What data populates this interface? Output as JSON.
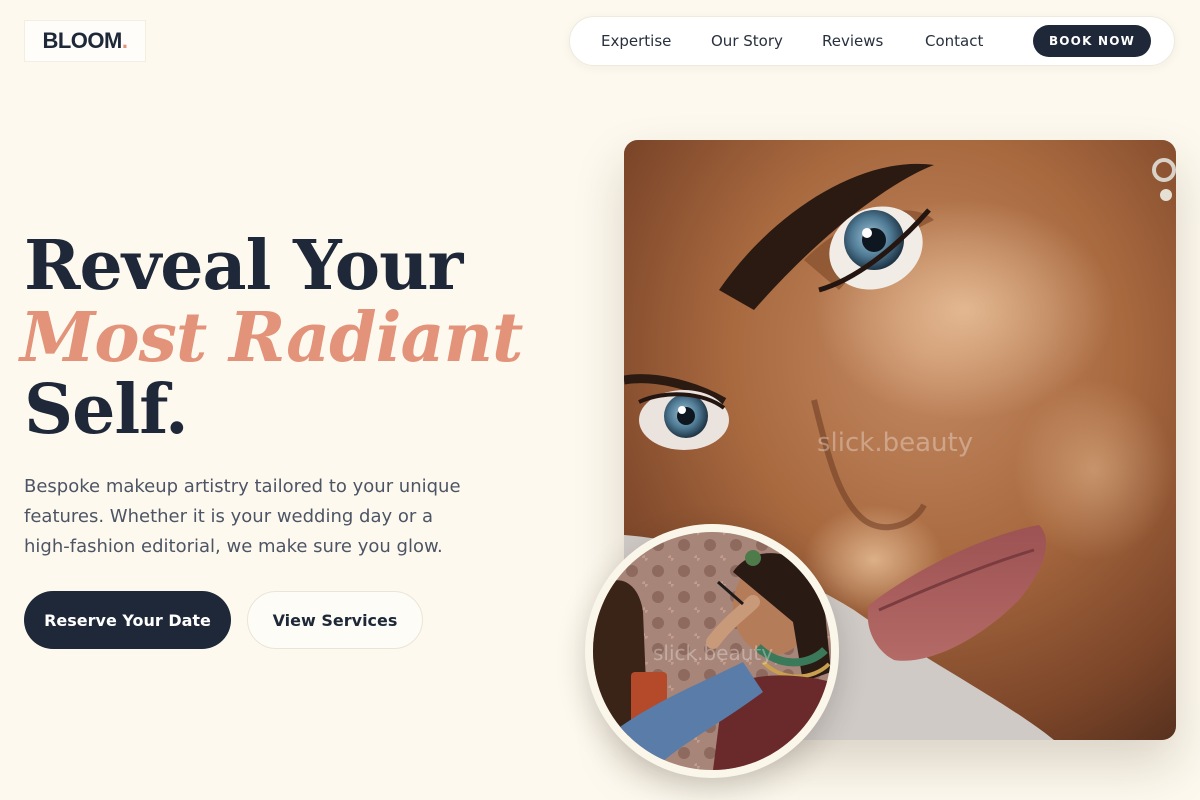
{
  "brand": {
    "name": "BLOOM",
    "dot": "."
  },
  "nav": {
    "links": [
      "Expertise",
      "Our Story",
      "Reviews",
      "Contact"
    ],
    "cta": "BOOK NOW"
  },
  "hero": {
    "headline_line1": "Reveal Your",
    "headline_accent": "Most Radiant",
    "headline_line3": "Self.",
    "description": "Bespoke makeup artistry tailored to your unique features. Whether it is your wedding day or a high-fashion editorial, we make sure you glow.",
    "primary_button": "Reserve Your Date",
    "secondary_button": "View Services"
  },
  "images": {
    "main_watermark": "slick.beauty",
    "inset_watermark": "slick.beauty"
  },
  "colors": {
    "background": "#fdf9ee",
    "navy": "#1e2838",
    "accent": "#e2937a"
  }
}
